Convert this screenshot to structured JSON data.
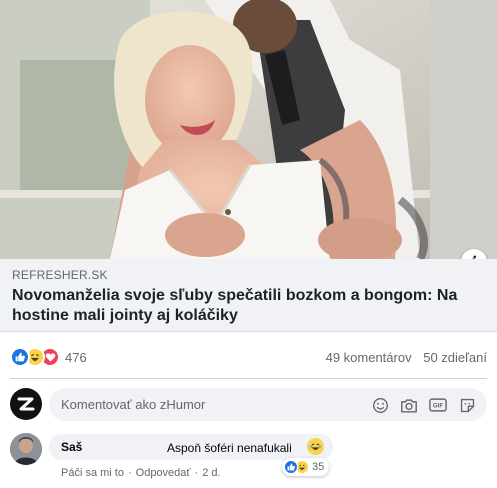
{
  "post": {
    "link": {
      "domain": "REFRESHER.SK",
      "headline": "Novomanželia svoje sľuby spečatili bozkom a bongom: Na hostine mali jointy aj koláčiky"
    },
    "info_icon": "info-icon",
    "reactions": {
      "types": [
        "like",
        "haha",
        "love"
      ],
      "count": "476",
      "comments": "49 komentárov",
      "shares": "50 zdieľaní"
    },
    "composer": {
      "placeholder": "Komentovať ako zHumor",
      "icons": [
        "emoji-icon",
        "camera-icon",
        "gif-icon",
        "sticker-icon"
      ]
    },
    "comment": {
      "author": "Saš",
      "text": "Aspoň šoféri nenafukali",
      "emoji": "laughing-tears-emoji",
      "reactions": [
        "like",
        "haha"
      ],
      "reaction_count": "35",
      "like_label": "Páči sa mi to",
      "reply_label": "Odpovedať",
      "time": "2 d."
    }
  }
}
